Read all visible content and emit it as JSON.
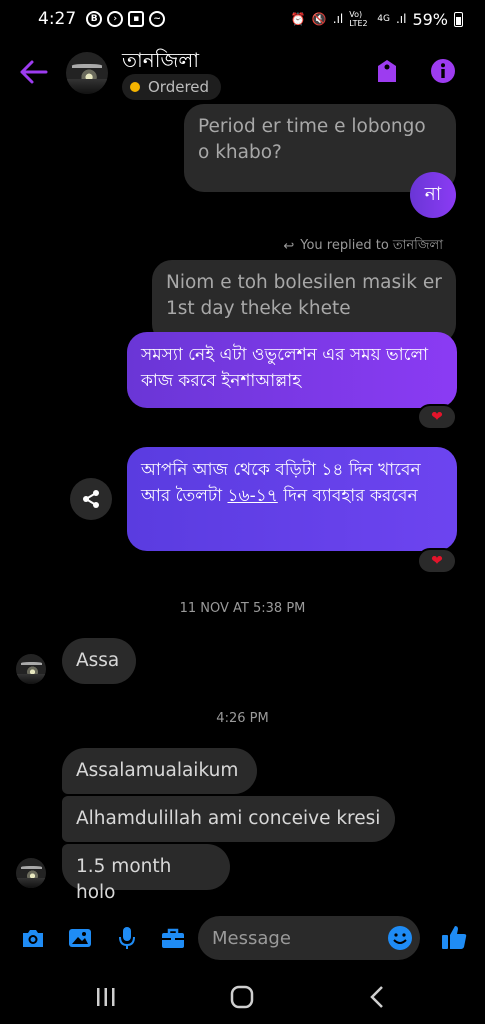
{
  "status_bar": {
    "time": "4:27",
    "left_icons": [
      "b-icon",
      "navigation-icon",
      "square-icon",
      "messenger-icon"
    ],
    "network": "Vo) LTE2",
    "network_type": "4G",
    "battery": "59%"
  },
  "header": {
    "contact_name": "তানজিলা",
    "order_status": "Ordered",
    "status_color": "#f5b400",
    "accent": "#9d3cf0"
  },
  "messages": {
    "m1": "Period er time e lobongo o khabo?",
    "m2": "না",
    "reply_note": "You replied to তানজিলা",
    "m3": "Niom e toh bolesilen masik er 1st day theke khete",
    "m4": "সমস্যা নেই এটা ওভুলেশন এর সময় ভালো কাজ করবে ইনশাআল্লাহ",
    "m5_a": "আপনি আজ থেকে বড়িটা ১৪ দিন খাবেন আর তৈলটা ",
    "m5_link": "১৬-১৭",
    "m5_b": " দিন ব্যাবহার করবেন",
    "sep1": "11 NOV AT 5:38 PM",
    "m6": "Assa",
    "sep2": "4:26 PM",
    "m7": "Assalamualaikum",
    "m8": "Alhamdulillah ami conceive kresi",
    "m9": "1.5 month holo"
  },
  "composer": {
    "placeholder": "Message"
  }
}
